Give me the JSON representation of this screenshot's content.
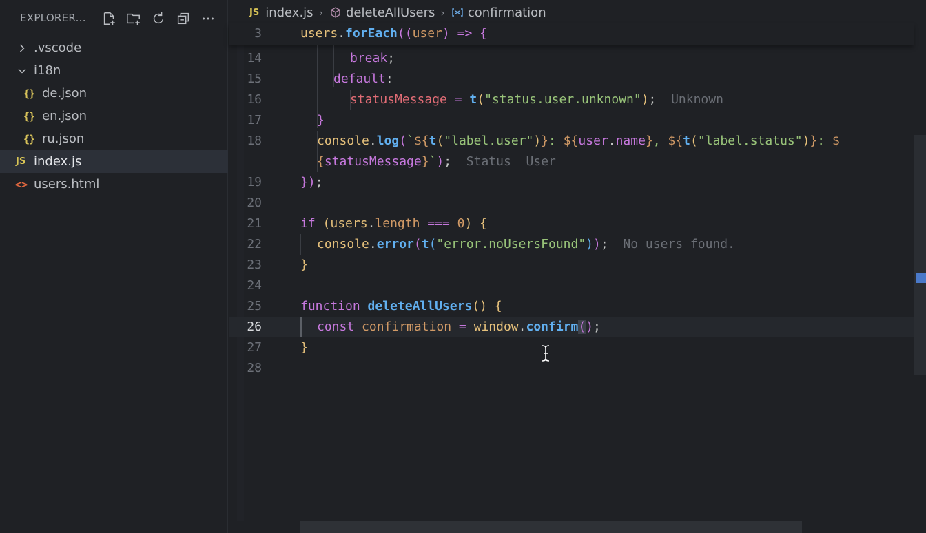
{
  "explorer": {
    "title": "EXPLORER...",
    "actions": [
      {
        "name": "new-file",
        "icon": "new-file-icon"
      },
      {
        "name": "new-folder",
        "icon": "new-folder-icon"
      },
      {
        "name": "refresh",
        "icon": "refresh-icon"
      },
      {
        "name": "collapse-all",
        "icon": "collapse-all-icon"
      },
      {
        "name": "more-actions",
        "icon": "ellipsis-icon"
      }
    ],
    "items": [
      {
        "label": ".vscode",
        "type": "folder",
        "expanded": false
      },
      {
        "label": "i18n",
        "type": "folder",
        "expanded": true
      },
      {
        "label": "de.json",
        "type": "json",
        "icon_text": "{}"
      },
      {
        "label": "en.json",
        "type": "json",
        "icon_text": "{}"
      },
      {
        "label": "ru.json",
        "type": "json",
        "icon_text": "{}"
      },
      {
        "label": "index.js",
        "type": "js",
        "icon_text": "JS",
        "active": true
      },
      {
        "label": "users.html",
        "type": "html",
        "icon_text": "<>"
      }
    ]
  },
  "breadcrumb": {
    "file_badge": "JS",
    "file": "index.js",
    "function": "deleteAllUsers",
    "variable": "confirmation"
  },
  "editor": {
    "current_line": "26",
    "line_numbers": {
      "l3": "3",
      "l14": "14",
      "l15": "15",
      "l16": "16",
      "l17": "17",
      "l18": "18",
      "l19": "19",
      "l20": "20",
      "l21": "21",
      "l22": "22",
      "l23": "23",
      "l24": "24",
      "l25": "25",
      "l26": "26",
      "l27": "27",
      "l28": "28"
    },
    "inlay_hints": {
      "l16": "Unknown",
      "l18a": "Status",
      "l18b": "User",
      "l22": "No users found."
    }
  },
  "colors": {
    "keyword": "#c678dd",
    "function": "#61afef",
    "string": "#98c379",
    "number": "#d19a66",
    "property": "#e5c07b",
    "background": "#1f2125",
    "active_item": "#2c3038"
  }
}
